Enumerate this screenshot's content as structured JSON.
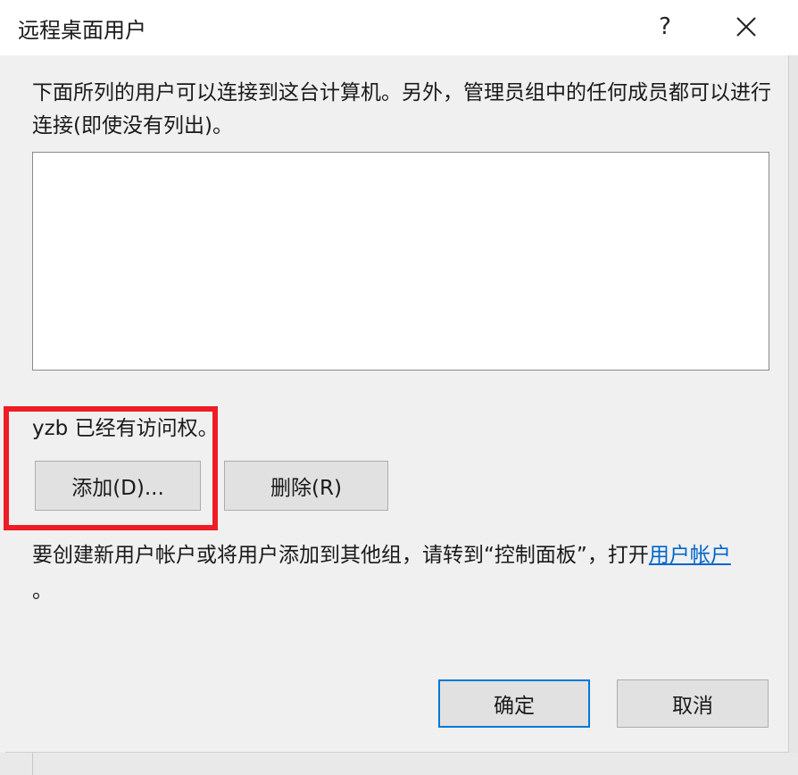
{
  "window": {
    "title": "远程桌面用户",
    "help_label": "?",
    "close_icon": "close-icon"
  },
  "description": "下面所列的用户可以连接到这台计算机。另外，管理员组中的任何成员都可以进行连接(即使没有列出)。",
  "user_list": {
    "items": []
  },
  "access_text": "yzb 已经有访问权。",
  "buttons": {
    "add": "添加(D)...",
    "remove": "删除(R)",
    "ok": "确定",
    "cancel": "取消"
  },
  "info": {
    "text": "要创建新用户帐户或将用户添加到其他组，请转到“控制面板”，打开",
    "link": "用户帐户",
    "suffix": "。"
  },
  "highlight_color": "#ee1c25",
  "accent_color": "#0078d7",
  "link_color": "#0066cc"
}
